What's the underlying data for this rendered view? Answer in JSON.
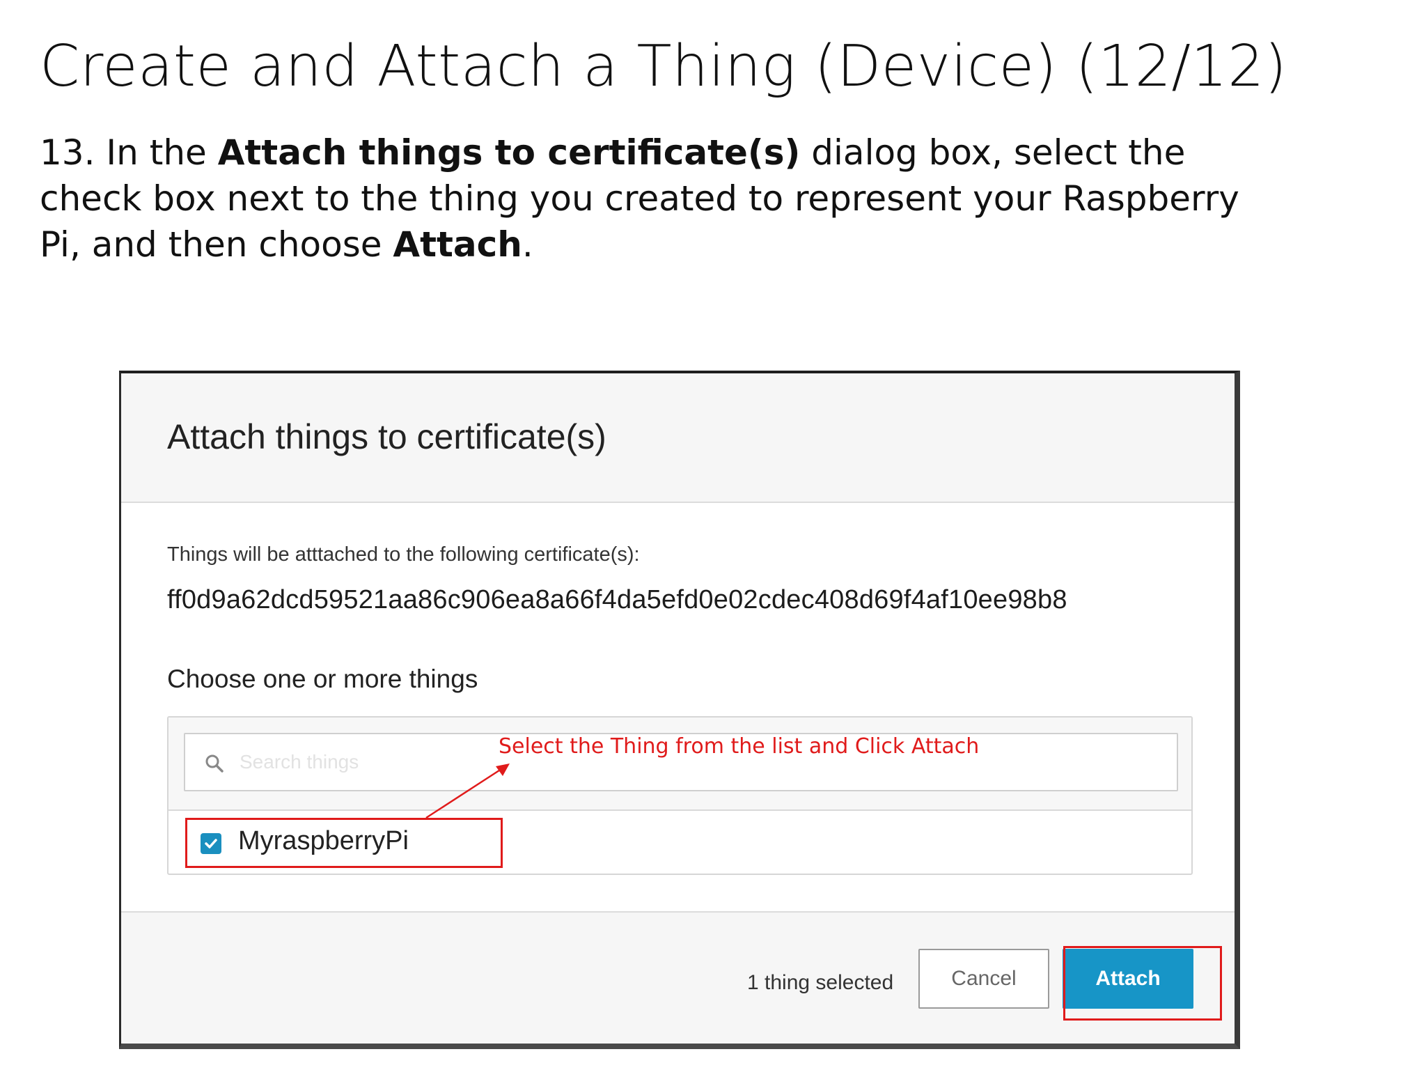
{
  "slide": {
    "title": "Create and Attach a Thing (Device) (12/12)",
    "instruction": {
      "part1": "13. In the ",
      "bold1": "Attach things to certificate(s)",
      "part2": " dialog box, select the check box next to the thing you created to represent your Raspberry Pi, and then choose ",
      "bold2": "Attach",
      "part3": "."
    }
  },
  "dialog": {
    "title": "Attach things to certificate(s)",
    "certificate_label": "Things will be atttached to the following certificate(s):",
    "certificate_id": "ff0d9a62dcd59521aa86c906ea8a66f4da5efd0e02cdec408d69f4af10ee98b8",
    "choose_label": "Choose one or more things",
    "search": {
      "placeholder": "Search things",
      "value": ""
    },
    "things": [
      {
        "name": "MyraspberryPi",
        "checked": true
      }
    ],
    "footer": {
      "selected_count": "1 thing selected",
      "cancel_label": "Cancel",
      "attach_label": "Attach"
    }
  },
  "annotation": {
    "text": "Select the Thing from the list and Click Attach",
    "color": "#e01b1b"
  },
  "colors": {
    "primary_button": "#1795c7",
    "checkbox": "#1a8fbf"
  }
}
